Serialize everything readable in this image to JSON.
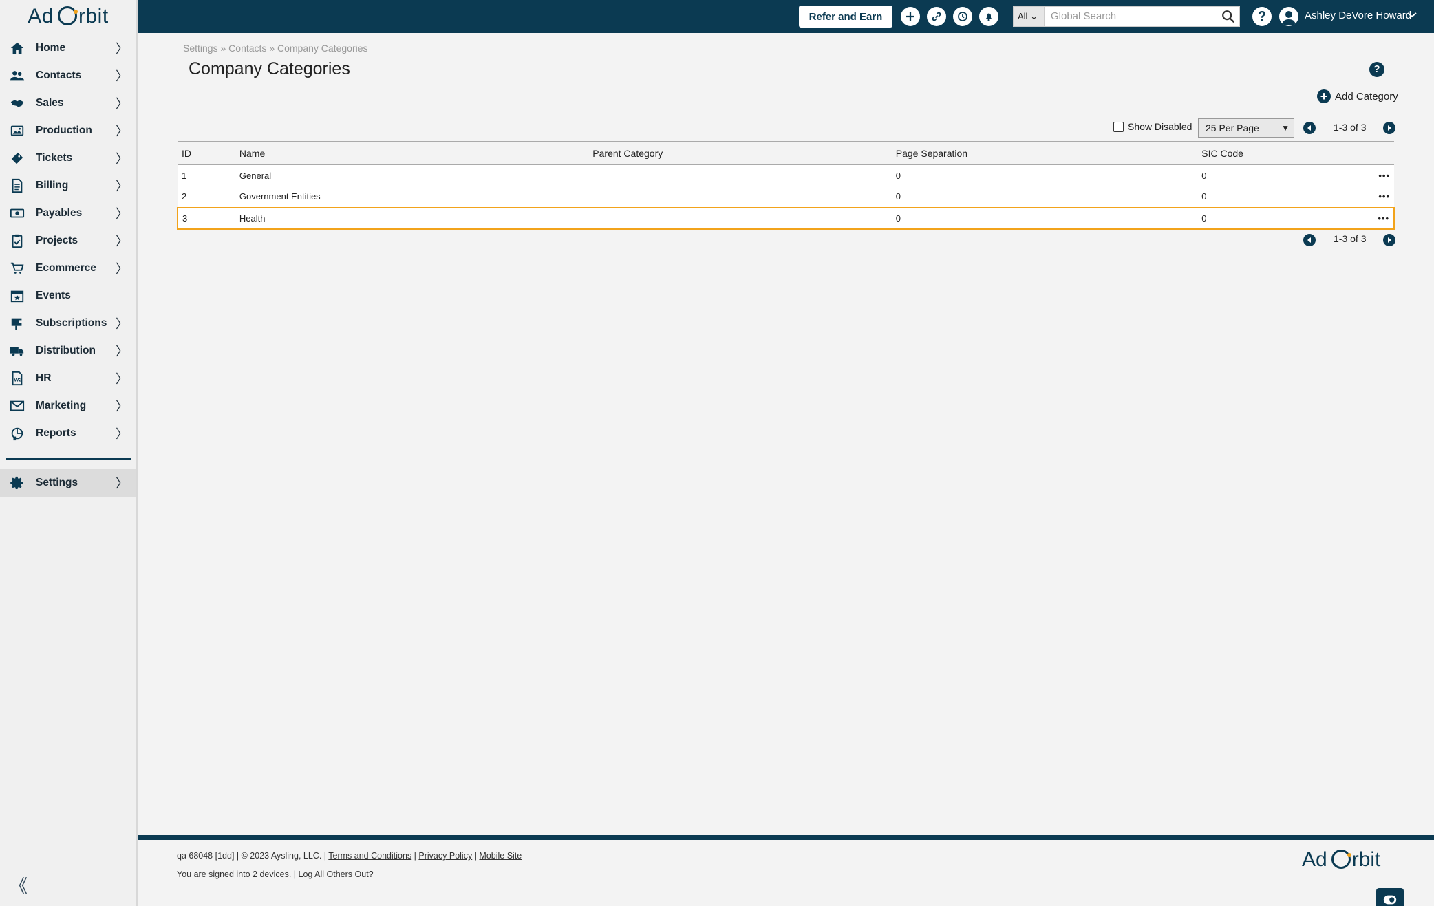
{
  "app": {
    "logo_text_left": "Ad",
    "logo_text_right": "rbit"
  },
  "sidebar": {
    "items": [
      {
        "label": "Home",
        "icon": "home-icon"
      },
      {
        "label": "Contacts",
        "icon": "contacts-icon"
      },
      {
        "label": "Sales",
        "icon": "sales-icon"
      },
      {
        "label": "Production",
        "icon": "production-icon"
      },
      {
        "label": "Tickets",
        "icon": "tickets-icon"
      },
      {
        "label": "Billing",
        "icon": "billing-icon"
      },
      {
        "label": "Payables",
        "icon": "payables-icon"
      },
      {
        "label": "Projects",
        "icon": "projects-icon"
      },
      {
        "label": "Ecommerce",
        "icon": "cart-icon"
      },
      {
        "label": "Events",
        "icon": "calendar-icon"
      },
      {
        "label": "Subscriptions",
        "icon": "subscriptions-icon"
      },
      {
        "label": "Distribution",
        "icon": "truck-icon"
      },
      {
        "label": "HR",
        "icon": "hr-icon"
      },
      {
        "label": "Marketing",
        "icon": "mail-icon"
      },
      {
        "label": "Reports",
        "icon": "reports-icon"
      }
    ],
    "settings_label": "Settings",
    "chevron": "〉",
    "collapse": "《"
  },
  "topbar": {
    "refer_label": "Refer and Earn",
    "search_scope": "All",
    "search_placeholder": "Global Search",
    "help": "?",
    "username": "Ashley DeVore Howard"
  },
  "page": {
    "breadcrumb": [
      "Settings",
      "Contacts",
      "Company Categories"
    ],
    "breadcrumb_sep": "»",
    "title": "Company Categories",
    "help": "?",
    "add_label": "Add Category",
    "show_disabled_label": "Show Disabled",
    "per_page": "25 Per Page",
    "pagination": "1-3 of 3"
  },
  "table": {
    "headers": [
      "ID",
      "Name",
      "Parent Category",
      "Page Separation",
      "SIC Code"
    ],
    "rows": [
      {
        "id": "1",
        "name": "General",
        "parent": "",
        "page_sep": "0",
        "sic": "0"
      },
      {
        "id": "2",
        "name": "Government Entities",
        "parent": "",
        "page_sep": "0",
        "sic": "0"
      },
      {
        "id": "3",
        "name": "Health",
        "parent": "",
        "page_sep": "0",
        "sic": "0"
      }
    ],
    "menu": "•••"
  },
  "footer": {
    "build": "qa 68048 [1dd] | © 2023 Aysling, LLC. |",
    "terms": "Terms and Conditions",
    "privacy": "Privacy Policy",
    "mobile": "Mobile Site",
    "sep": "|",
    "signed_in": "You are signed into 2 devices. |",
    "logout_others": "Log All Others Out?"
  },
  "colors": {
    "brand": "#0b3a52",
    "accent": "#f2a31b"
  }
}
